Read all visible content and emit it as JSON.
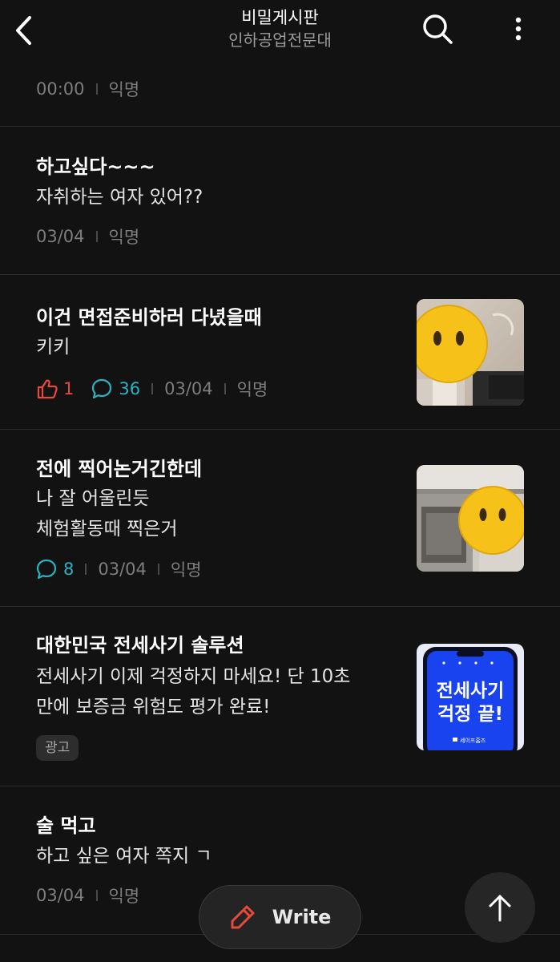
{
  "header": {
    "title": "비밀게시판",
    "subtitle": "인하공업전문대"
  },
  "posts": [
    {
      "time": "00:00",
      "author": "익명"
    },
    {
      "title": "하고싶다~~~",
      "body": "자취하는 여자 있어??",
      "date": "03/04",
      "author": "익명"
    },
    {
      "title": "이건 면접준비하러 다녔을때",
      "body": "키키",
      "likes": "1",
      "comments": "36",
      "date": "03/04",
      "author": "익명"
    },
    {
      "title": "전에 찍어논거긴한데",
      "body_line1": "나 잘 어울린듯",
      "body_line2": "체험활동때 찍은거",
      "comments": "8",
      "date": "03/04",
      "author": "익명"
    },
    {
      "title": "대한민국 전세사기 솔루션",
      "body_line1": "전세사기 이제 걱정하지 마세요! 단 10초",
      "body_line2": "만에 보증금 위험도 평가 완료!",
      "badge": "광고",
      "ad_image_line1": "전세사기",
      "ad_image_line2": "걱정 끝!",
      "ad_image_brand": "세이프홈즈"
    },
    {
      "title": "술 먹고",
      "body": "하고 싶은 여자 쪽지 ㄱ",
      "date": "03/04",
      "author": "익명"
    }
  ],
  "write_button": {
    "label": "Write"
  },
  "colors": {
    "background": "#121212",
    "like": "#e64a3c",
    "comment": "#2bb3c0",
    "ad_blue": "#1a43f0",
    "emoji_yellow": "#f6c21a"
  },
  "icons": {
    "back": "chevron-left-icon",
    "search": "search-icon",
    "more": "more-vertical-icon",
    "like": "thumbs-up-icon",
    "comment": "comment-bubble-icon",
    "write": "pencil-icon",
    "top": "arrow-up-icon"
  }
}
